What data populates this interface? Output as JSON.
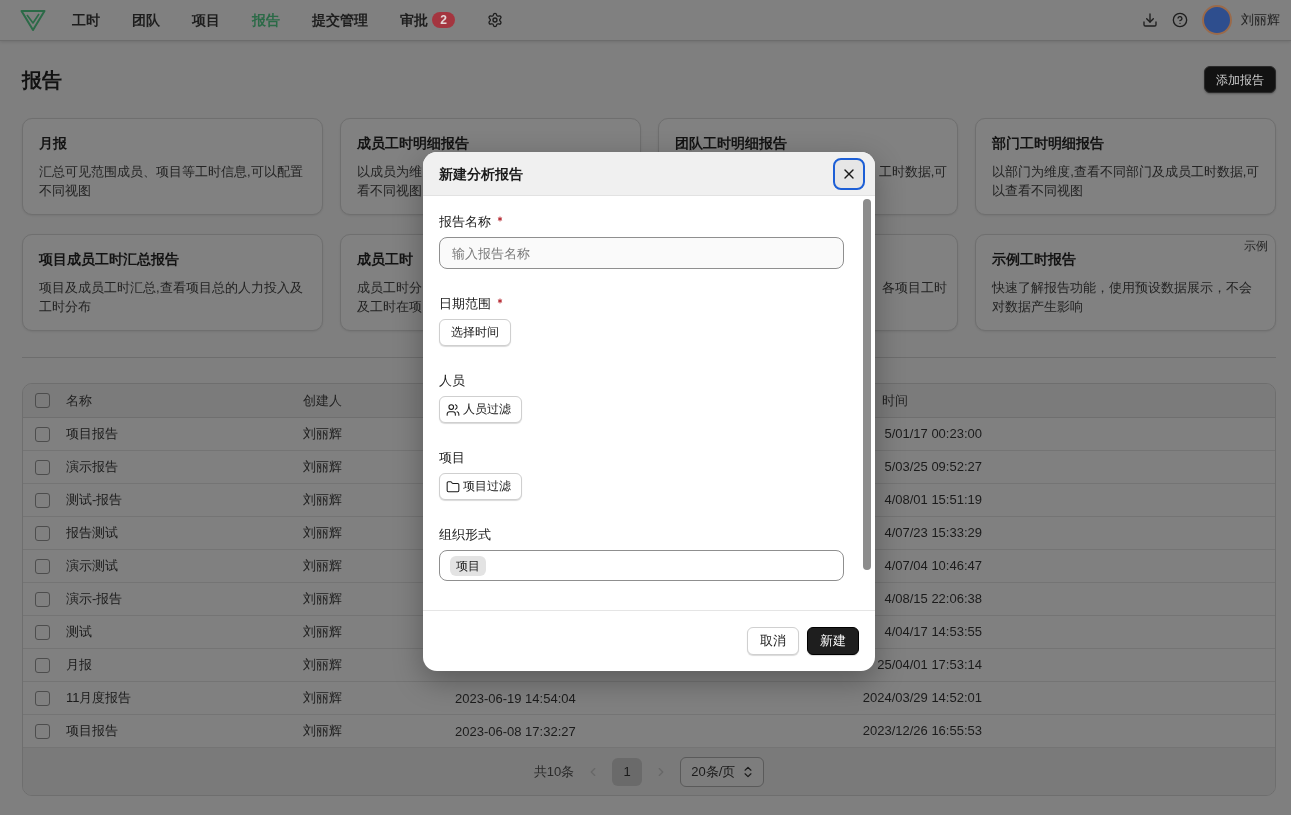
{
  "nav": {
    "items": [
      {
        "label": "工时",
        "selected": false
      },
      {
        "label": "团队",
        "selected": false
      },
      {
        "label": "项目",
        "selected": false
      },
      {
        "label": "报告",
        "selected": true
      },
      {
        "label": "提交管理",
        "selected": false
      },
      {
        "label": "审批",
        "selected": false,
        "badge": "2"
      }
    ],
    "user": {
      "name": "刘丽辉"
    }
  },
  "page": {
    "title": "报告",
    "add_button": "添加报告"
  },
  "cards": [
    {
      "kind": "full",
      "title": "月报",
      "description": "汇总可见范围成员、项目等工时信息,可以配置不同视图"
    },
    {
      "kind": "left_part",
      "title": "成员工时明细报告",
      "fragments": [
        "以成员为维",
        "看不同视图"
      ]
    },
    {
      "kind": "right_part",
      "title": "团队工时明细报告",
      "fragments": [
        "工时数据,可"
      ]
    },
    {
      "kind": "full",
      "title": "部门工时明细报告",
      "description": "以部门为维度,查看不同部门及成员工时数据,可以查看不同视图"
    },
    {
      "kind": "full",
      "title": "项目成员工时汇总报告",
      "description": "项目及成员工时汇总,查看项目总的人力投入及工时分布"
    },
    {
      "kind": "left_part",
      "title": "成员工时",
      "fragments": [
        "成员工时分",
        "及工时在项"
      ]
    },
    {
      "kind": "right_part",
      "fragments": [
        "各项目工时"
      ]
    },
    {
      "kind": "full",
      "title": "示例工时报告",
      "badge": "示例",
      "description": "快速了解报告功能，使用预设数据展示，不会对数据产生影响"
    }
  ],
  "table": {
    "select_all": {
      "checked": false
    },
    "columns": {
      "name": "名称",
      "creator": "创建人",
      "column_4": "时间"
    },
    "rows": [
      {
        "checked": false,
        "name": "项目报告",
        "creator": "刘丽辉",
        "column_4": "5/01/17 00:23:00"
      },
      {
        "checked": false,
        "name": "演示报告",
        "creator": "刘丽辉",
        "column_4": "5/03/25 09:52:27"
      },
      {
        "checked": false,
        "name": "测试-报告",
        "creator": "刘丽辉",
        "column_4": "4/08/01 15:51:19"
      },
      {
        "checked": false,
        "name": "报告测试",
        "creator": "刘丽辉",
        "column_4": "4/07/23 15:33:29"
      },
      {
        "checked": false,
        "name": "演示测试",
        "creator": "刘丽辉",
        "column_4": "4/07/04 10:46:47"
      },
      {
        "checked": false,
        "name": "演示-报告",
        "creator": "刘丽辉",
        "column_4": "4/08/15 22:06:38"
      },
      {
        "checked": false,
        "name": "测试",
        "creator": "刘丽辉",
        "column_4": "4/04/17 14:53:55"
      },
      {
        "checked": false,
        "name": "月报",
        "creator": "刘丽辉",
        "column_4": "25/04/01 17:53:14"
      },
      {
        "checked": false,
        "name": "11月度报告",
        "creator": "刘丽辉",
        "column_3": "2023-06-19 14:54:04",
        "column_4": "2024/03/29 14:52:01"
      },
      {
        "checked": false,
        "name": "项目报告",
        "creator": "刘丽辉",
        "column_3": "2023-06-08 17:32:27",
        "column_4": "2023/12/26 16:55:53"
      }
    ]
  },
  "pagination": {
    "total": "共10条",
    "prev": {
      "disabled": true
    },
    "pages": [
      {
        "label": "1",
        "selected": true
      }
    ],
    "next": {
      "disabled": true
    },
    "page_size": "20条/页"
  },
  "dialog": {
    "title": "新建分析报告",
    "close_focused": true,
    "fields": [
      {
        "kind": "input",
        "label": "报告名称",
        "required": true,
        "placeholder": "输入报告名称"
      },
      {
        "kind": "button",
        "label": "日期范围",
        "required": true,
        "button": "选择时间"
      },
      {
        "kind": "people_filter",
        "label": "人员",
        "required": false,
        "button": "人员过滤"
      },
      {
        "kind": "project_filter",
        "label": "项目",
        "required": false,
        "button": "项目过滤"
      },
      {
        "kind": "tags",
        "label": "组织形式",
        "required": false,
        "tags": [
          "项目"
        ]
      }
    ],
    "buttons": [
      {
        "kind": "secondary",
        "label": "取消"
      },
      {
        "kind": "primary",
        "label": "新建"
      }
    ]
  }
}
